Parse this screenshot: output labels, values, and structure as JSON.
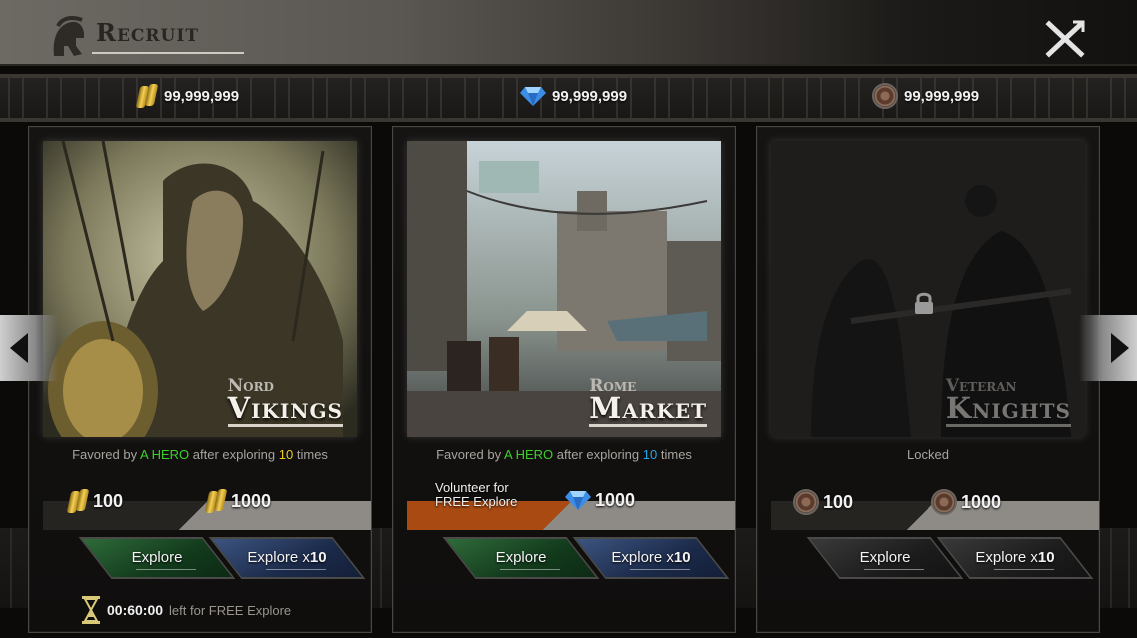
{
  "header": {
    "title": "Recruit"
  },
  "currencies": [
    {
      "icon": "gold-ingot-icon",
      "value": "99,999,999"
    },
    {
      "icon": "gem-icon",
      "value": "99,999,999"
    },
    {
      "icon": "shield-token-icon",
      "value": "99,999,999"
    }
  ],
  "panels": [
    {
      "subtitle": "Nord",
      "name": "Vikings",
      "favor": {
        "pre": "Favored by",
        "hero": "A HERO",
        "mid": "after exploring",
        "count": "10",
        "post": "times"
      },
      "cost1": "100",
      "cost2": "1000",
      "explore": "Explore",
      "explore10_prefix": "Explore x",
      "explore10_num": "10",
      "timer": {
        "time": "00:60:00",
        "text": "left for FREE Explore"
      }
    },
    {
      "subtitle": "Rome",
      "name": "Market",
      "favor": {
        "pre": "Favored by",
        "hero": "A HERO",
        "mid": "after exploring",
        "count": "10",
        "post": "times"
      },
      "volunteer_line1": "Volunteer for",
      "volunteer_line2": "FREE Explore",
      "cost2": "1000",
      "explore": "Explore",
      "explore10_prefix": "Explore x",
      "explore10_num": "10"
    },
    {
      "subtitle": "Veteran",
      "name": "Knights",
      "status": "Locked",
      "cost1": "100",
      "cost2": "1000",
      "explore": "Explore",
      "explore10_prefix": "Explore x",
      "explore10_num": "10"
    }
  ],
  "colors": {
    "hero_green": "#3cd02a",
    "count_yellow": "#e8cc20",
    "count_blue": "#29a4e8",
    "volunteer_orange": "#a84a12"
  }
}
